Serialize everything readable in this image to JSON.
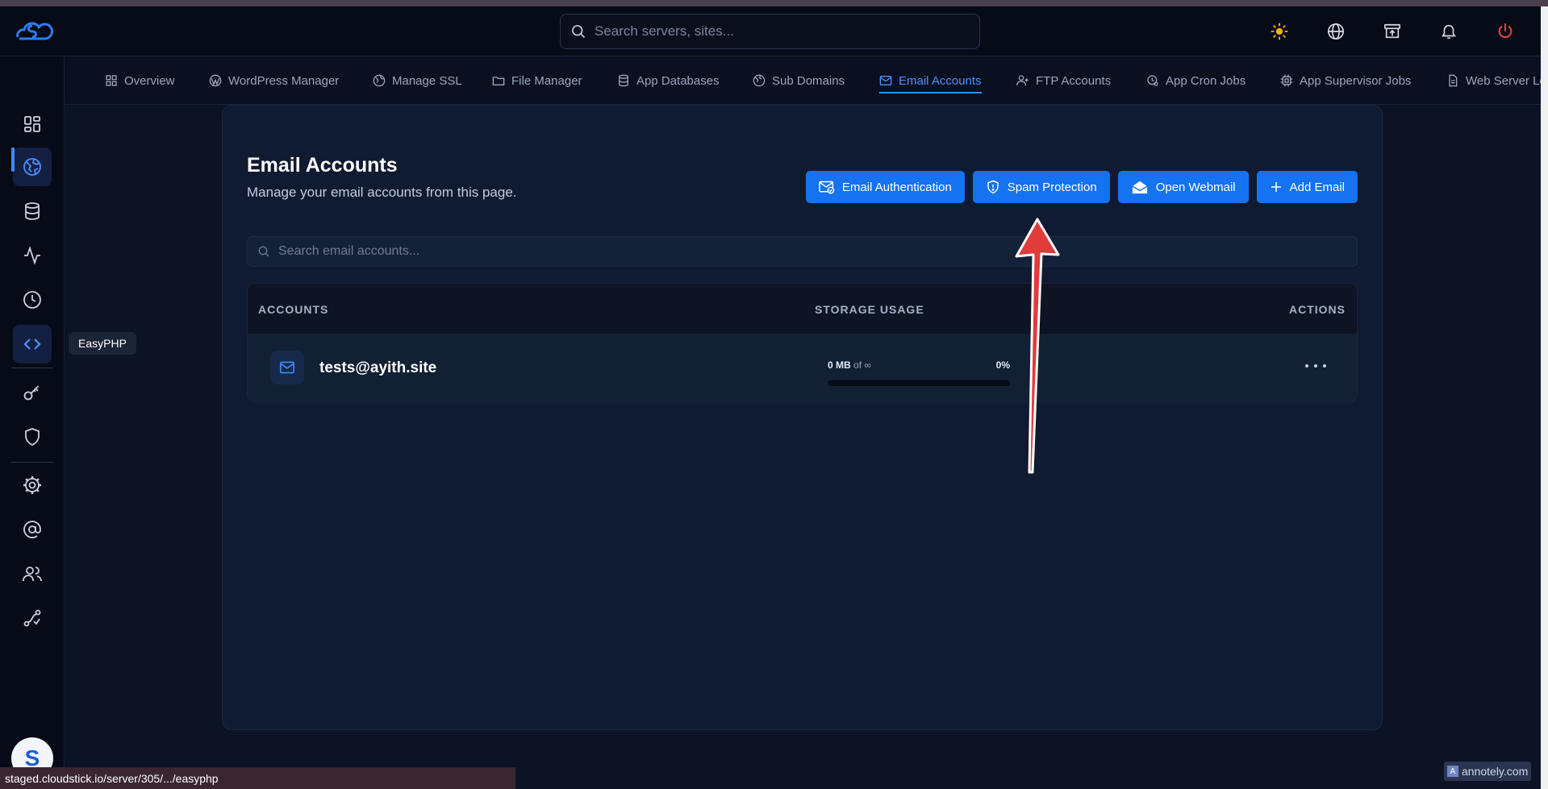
{
  "topbar": {
    "search_placeholder": "Search servers, sites...",
    "icons": [
      "sun-icon",
      "globe-icon",
      "archive-icon",
      "bell-icon",
      "power-icon"
    ]
  },
  "sidebar": {
    "tooltip": "EasyPHP",
    "avatar_letter": "S",
    "icons": [
      "dashboard-icon",
      "web-icon",
      "database-icon",
      "activity-icon",
      "clock-icon",
      "code-icon",
      "key-icon",
      "shield-icon",
      "cog-icon",
      "at-icon",
      "users-icon",
      "route-icon"
    ]
  },
  "tabs": [
    {
      "label": "Overview",
      "icon": "grid-icon"
    },
    {
      "label": "WordPress Manager",
      "icon": "wordpress-icon"
    },
    {
      "label": "Manage SSL",
      "icon": "ssl-icon"
    },
    {
      "label": "File Manager",
      "icon": "folder-icon"
    },
    {
      "label": "App Databases",
      "icon": "database-icon"
    },
    {
      "label": "Sub Domains",
      "icon": "globe-icon"
    },
    {
      "label": "Email Accounts",
      "icon": "mail-icon",
      "active": true
    },
    {
      "label": "FTP Accounts",
      "icon": "user-plus-icon"
    },
    {
      "label": "App Cron Jobs",
      "icon": "cron-icon"
    },
    {
      "label": "App Supervisor Jobs",
      "icon": "chip-icon"
    },
    {
      "label": "Web Server Lo",
      "icon": "file-icon"
    }
  ],
  "page": {
    "title": "Email Accounts",
    "subtitle": "Manage your email accounts from this page.",
    "buttons": {
      "email_auth": "Email Authentication",
      "spam": "Spam Protection",
      "webmail": "Open Webmail",
      "add": "Add Email"
    },
    "search_placeholder": "Search email accounts..."
  },
  "table": {
    "headers": {
      "accounts": "ACCOUNTS",
      "storage": "STORAGE USAGE",
      "actions": "ACTIONS"
    },
    "rows": [
      {
        "email": "tests@ayith.site",
        "used": "0 MB",
        "of": "of",
        "quota": "∞",
        "percent": "0%",
        "percent_value": 0
      }
    ]
  },
  "statusbar": {
    "url": "staged.cloudstick.io/server/305/.../easyphp"
  },
  "watermark": {
    "text": "annotely.com"
  },
  "colors": {
    "accent": "#1572f0",
    "active_tab": "#4a90ff",
    "power": "#e8453c",
    "sun": "#f5b400",
    "arrow": "#e23b3b"
  }
}
